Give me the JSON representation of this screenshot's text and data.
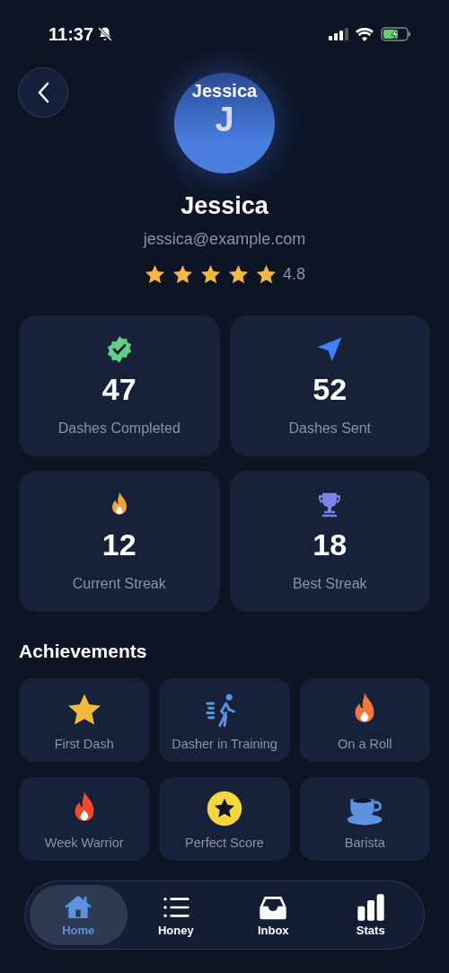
{
  "status_bar": {
    "time": "11:37",
    "silent": true
  },
  "profile": {
    "avatar_label": "Jessica",
    "initial": "J",
    "name": "Jessica",
    "email": "jessica@example.com",
    "stars": 5,
    "rating": "4.8"
  },
  "stats": [
    {
      "kind": "badge",
      "color": "#5fcf8a",
      "value": "47",
      "label": "Dashes Completed"
    },
    {
      "kind": "send",
      "color": "#3b82f6",
      "value": "52",
      "label": "Dashes Sent"
    },
    {
      "kind": "flame",
      "color": "#f2a33a",
      "value": "12",
      "label": "Current Streak"
    },
    {
      "kind": "trophy",
      "color": "#7b83e8",
      "value": "18",
      "label": "Best Streak"
    }
  ],
  "achievements_title": "Achievements",
  "achievements": [
    {
      "kind": "star",
      "color": "#f4b740",
      "label": "First Dash"
    },
    {
      "kind": "walker",
      "color": "#5b93e0",
      "label": "Dasher in Training"
    },
    {
      "kind": "flame",
      "color": "#f2773a",
      "label": "On a Roll"
    },
    {
      "kind": "flame",
      "color": "#ef4b2b",
      "label": "Week Warrior"
    },
    {
      "kind": "coin",
      "color": "#f5d63d",
      "label": "Perfect Score"
    },
    {
      "kind": "cup",
      "color": "#5b93e0",
      "label": "Barista"
    }
  ],
  "tabs": [
    {
      "kind": "home",
      "label": "Home",
      "selected": true
    },
    {
      "kind": "list",
      "label": "Honey",
      "selected": false
    },
    {
      "kind": "inbox",
      "label": "Inbox",
      "selected": false
    },
    {
      "kind": "stats",
      "label": "Stats",
      "selected": false
    }
  ]
}
